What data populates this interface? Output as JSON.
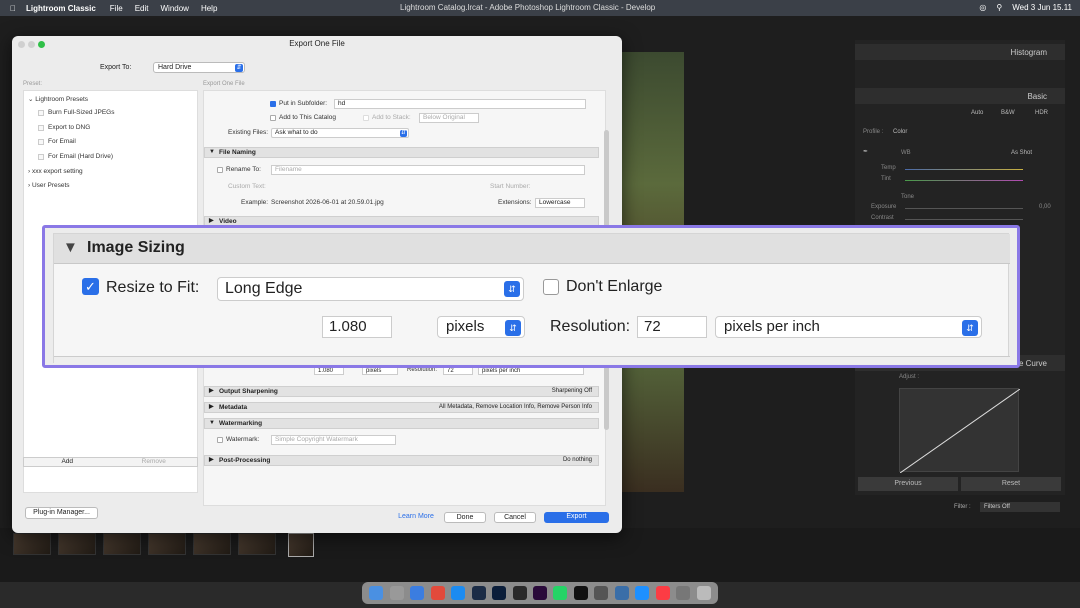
{
  "menubar": {
    "app_name": "Lightroom Classic",
    "items": [
      "File",
      "Edit",
      "Window",
      "Help"
    ],
    "window_title": "Lightroom Catalog.lrcat - Adobe Photoshop Lightroom Classic - Develop",
    "datetime": "Wed 3 Jun  15.11"
  },
  "right_panel": {
    "histogram": "Histogram",
    "basic": "Basic",
    "auto": "Auto",
    "bw": "B&W",
    "hdr": "HDR",
    "profile_label": "Profile :",
    "profile_value": "Color",
    "wb_label": "WB",
    "wb_value": "As Shot",
    "temp": "Temp",
    "tint": "Tint",
    "tone": "Tone",
    "exposure": "Exposure",
    "exposure_value": "0,00",
    "contrast": "Contrast",
    "zero": "0",
    "tone_curve": "e Curve",
    "adjust": "Adjust :",
    "previous": "Previous",
    "reset": "Reset",
    "filter_label": "Filter :",
    "filter_value": "Filters Off"
  },
  "dialog": {
    "title": "Export One File",
    "export_to_label": "Export To:",
    "export_to_value": "Hard Drive",
    "preset_label": "Preset:",
    "eof_label": "Export One File",
    "presets": {
      "lightroom": "Lightroom Presets",
      "items": [
        "Burn Full-Sized JPEGs",
        "Export to DNG",
        "For Email",
        "For Email (Hard Drive)"
      ],
      "xxx": "xxx export setting",
      "user": "User Presets"
    },
    "add": "Add",
    "remove": "Remove",
    "plugin_manager": "Plug-in Manager...",
    "put_in_subfolder": "Put in Subfolder:",
    "subfolder_value": "hd",
    "add_to_catalog": "Add to This Catalog",
    "add_to_stack": "Add to Stack:",
    "below_original": "Below Original",
    "existing_files_label": "Existing Files:",
    "existing_files_value": "Ask what to do",
    "file_naming": "File Naming",
    "rename_to": "Rename To:",
    "filename": "Filename",
    "custom_text": "Custom Text:",
    "start_number": "Start Number:",
    "example_label": "Example:",
    "example_value": "Screenshot 2026-06-01 at 20.59.01.jpg",
    "extensions_label": "Extensions:",
    "extensions_value": "Lowercase",
    "video": "Video",
    "small_size": "1.080",
    "small_pixels": "pixels",
    "small_res_label": "Resolution:",
    "small_res": "72",
    "small_ppi": "pixels per inch",
    "output_sharpening": "Output Sharpening",
    "sharpening_off": "Sharpening Off",
    "metadata": "Metadata",
    "metadata_value": "All Metadata, Remove Location Info, Remove Person Info",
    "watermarking": "Watermarking",
    "watermark_label": "Watermark:",
    "watermark_value": "Simple Copyright Watermark",
    "post_processing": "Post-Processing",
    "do_nothing": "Do nothing",
    "learn_more": "Learn More",
    "done": "Done",
    "cancel": "Cancel",
    "export": "Export"
  },
  "image_sizing": {
    "title": "Image Sizing",
    "resize_to_fit": "Resize to Fit:",
    "resize_mode": "Long Edge",
    "dont_enlarge": "Don't Enlarge",
    "size_value": "1.080",
    "units": "pixels",
    "resolution_label": "Resolution:",
    "resolution_value": "72",
    "resolution_units": "pixels per inch"
  },
  "colors": {
    "accent": "#2a6fe8",
    "highlight_border": "#8a78e6"
  }
}
